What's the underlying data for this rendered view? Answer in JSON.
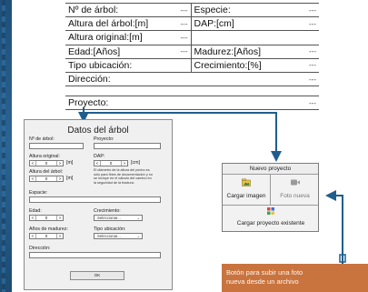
{
  "summary": {
    "rows": [
      {
        "l": "Nº de árbol:",
        "lv": "---",
        "r": "Especie:",
        "rv": "---"
      },
      {
        "l": "Altura del árbol:[m]",
        "lv": "---",
        "r": "DAP:[cm]",
        "rv": "---"
      },
      {
        "l": "Altura original:[m]",
        "lv": "---",
        "r": "",
        "rv": ""
      },
      {
        "l": "Edad:[Años]",
        "lv": "---",
        "r": "Madurez:[Años]",
        "rv": "---"
      },
      {
        "l": "Tipo ubicación:",
        "lv": "",
        "r": "Crecimiento:[%]",
        "rv": "---"
      },
      {
        "l": "Dirección:",
        "lv": "",
        "r": "",
        "rv": "---"
      },
      {
        "l": "Proyecto:",
        "lv": "",
        "r": "",
        "rv": "---"
      }
    ]
  },
  "dialog": {
    "title": "Datos del árbol",
    "tree_no_label": "Nº de árbol:",
    "project_label": "Proyecto:",
    "orig_height_label": "Altura original:",
    "dap_label": "DAP:",
    "tree_height_label": "Altura del árbol:",
    "species_label": "Espacie:",
    "age_label": "Edad:",
    "growth_label": "Crecimiento:",
    "maturity_label": "Años de madurez:",
    "location_type_label": "Tipo ubicación:",
    "address_label": "Dirección:",
    "unit_m": "[m]",
    "unit_cm": "[cm]",
    "spin_value": "0",
    "spin_minus": "<",
    "spin_plus": ">",
    "select_placeholder": "Seleccionar...",
    "dap_note": "El diámetro de la altura del pecho es sólo para fines de documentación y no se incluye en el cálculo del camino en la seguridad de la fractura.",
    "ok_label": "OK"
  },
  "new_project": {
    "title": "Nuevo proyecto",
    "load_image": "Cargar imagen",
    "new_photo": "Foto nueva",
    "load_existing": "Cargar proyecto existente"
  },
  "tooltip": {
    "line1": "Botón para subir una foto",
    "line2": "nueva desde un archivo"
  },
  "colors": {
    "arrow": "#1f5e8c",
    "tooltip_bg": "#c9743f",
    "strip": "#1f4f7a"
  }
}
